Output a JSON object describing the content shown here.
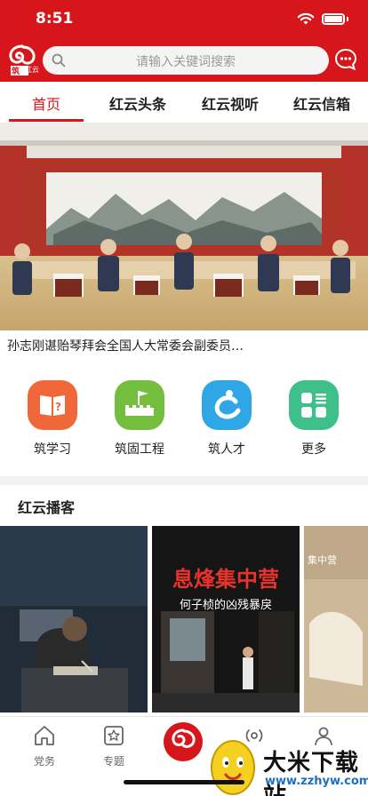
{
  "status": {
    "time": "8:51"
  },
  "header": {
    "logo_text": "红云",
    "search_placeholder": "请输入关键词搜索"
  },
  "tabs": [
    {
      "label": "首页",
      "active": true
    },
    {
      "label": "红云头条"
    },
    {
      "label": "红云视听"
    },
    {
      "label": "红云信箱"
    }
  ],
  "hero": {
    "caption": "孙志刚谌贻琴拜会全国人大常委会副委员…"
  },
  "quick_links": [
    {
      "label": "筑学习",
      "icon": "book-question-icon",
      "color": "#f0673a"
    },
    {
      "label": "筑固工程",
      "icon": "great-wall-flag-icon",
      "color": "#73be3f"
    },
    {
      "label": "筑人才",
      "icon": "person-c-icon",
      "color": "#2fa7e6"
    },
    {
      "label": "更多",
      "icon": "grid-more-icon",
      "color": "#3fc08a"
    }
  ],
  "podcast": {
    "title": "红云播客",
    "card2_title": "息烽集中营",
    "card2_subtitle": "何子桢的凶残暴戾",
    "card3_label": "集中营"
  },
  "tabbar": [
    {
      "label": "党务",
      "icon": "house-icon"
    },
    {
      "label": "专题",
      "icon": "star-box-icon"
    },
    {
      "label": "",
      "icon": "hongyun-logo-icon"
    },
    {
      "label": "",
      "icon": "radio-icon"
    },
    {
      "label": "",
      "icon": "person-icon"
    }
  ],
  "watermark": {
    "title": "大米下载站",
    "url": "www.zzhyw.com"
  },
  "colors": {
    "brand_red": "#d7161c"
  }
}
